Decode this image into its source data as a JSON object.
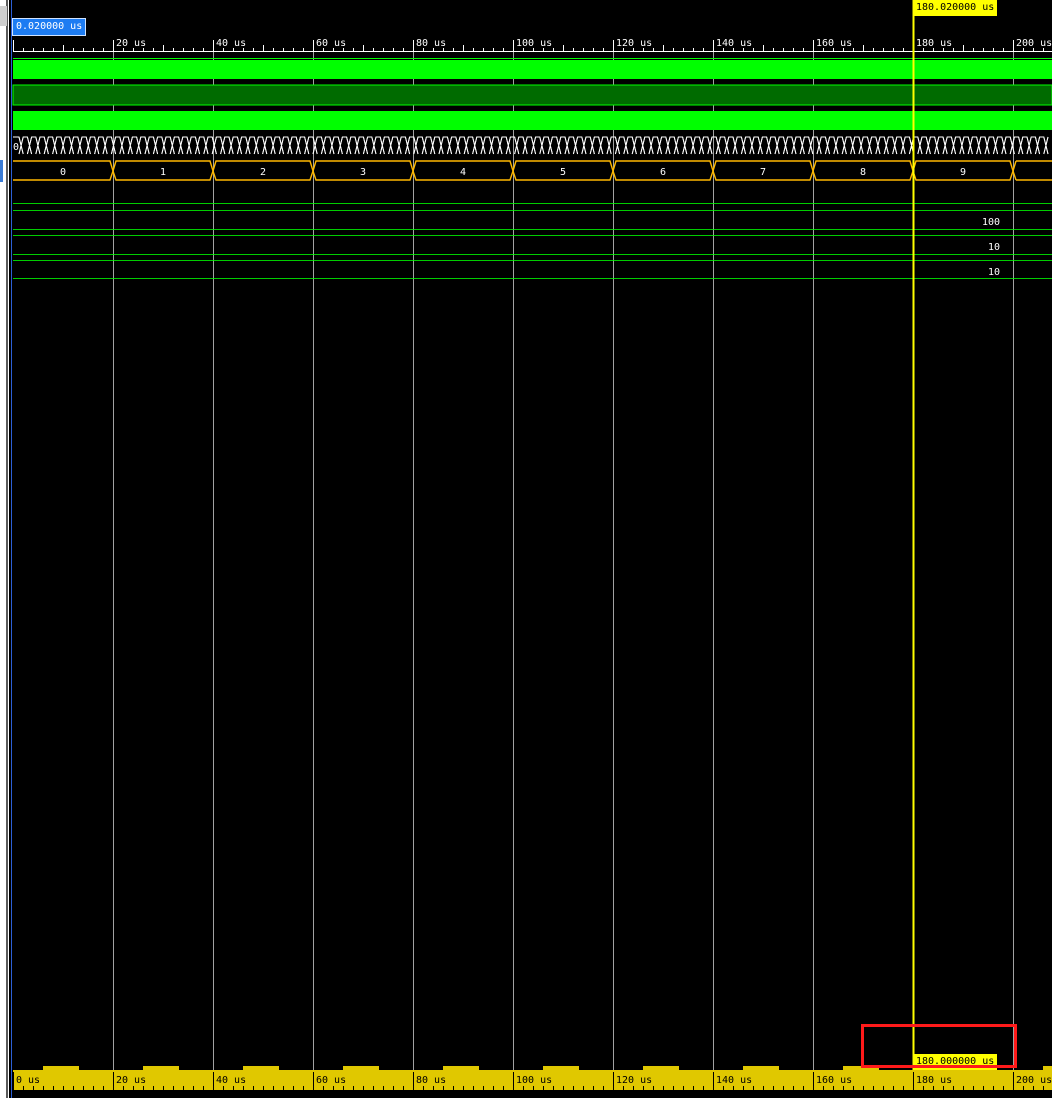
{
  "timeline": {
    "tick_labels": [
      "20 us",
      "40 us",
      "60 us",
      "80 us",
      "100 us",
      "120 us",
      "140 us",
      "160 us",
      "180 us",
      "200 us"
    ],
    "bottom_tick_labels": [
      "0 us",
      "20 us",
      "40 us",
      "60 us",
      "80 us",
      "100 us",
      "120 us",
      "140 us",
      "160 us",
      "180 us",
      "200 us"
    ]
  },
  "cursors": {
    "start": "0.020000 us",
    "main_top": "180.020000 us",
    "main_bottom": "180.000000 us"
  },
  "signals": {
    "counter_start_label": "0",
    "counter_segments": [
      "0",
      "1",
      "2",
      "3",
      "4",
      "5",
      "6",
      "7",
      "8",
      "9"
    ],
    "value_rows": [
      "100",
      "10",
      "10"
    ]
  },
  "colors": {
    "grid": "#d8d8d8",
    "signal_green": "#00ff00",
    "signal_dark_green": "#006b00",
    "bus_yellow": "#ffb800",
    "cursor_yellow": "#ffff00",
    "ruler_yellow": "#e0c800",
    "alt_bus": "#ffffff"
  }
}
